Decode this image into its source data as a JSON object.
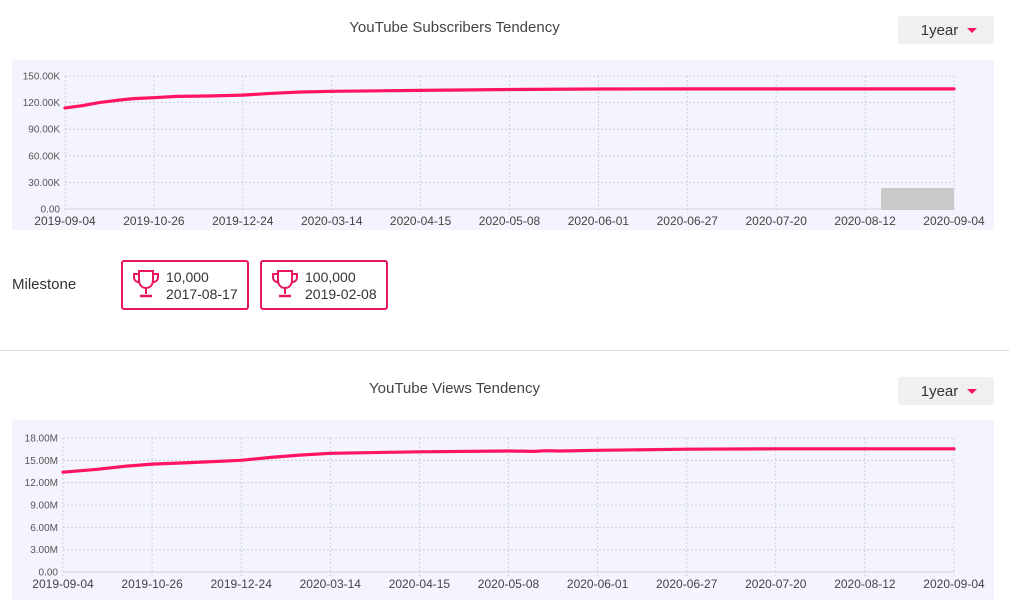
{
  "colors": {
    "line": "#ff1464",
    "plot_bg": "#f3f4fd",
    "grid": "#c8cad6",
    "brush": "#c9c9c9"
  },
  "subscribers": {
    "title": "YouTube Subscribers Tendency",
    "period_label": "1year"
  },
  "milestone": {
    "label": "Milestone",
    "badges": [
      {
        "value": "10,000",
        "date": "2017-08-17",
        "icon": "trophy-icon"
      },
      {
        "value": "100,000",
        "date": "2019-02-08",
        "icon": "trophy-icon"
      }
    ]
  },
  "views": {
    "title": "YouTube Views Tendency",
    "period_label": "1year"
  },
  "chart_data": [
    {
      "type": "line",
      "title": "YouTube Subscribers Tendency",
      "x_ticks": [
        "2019-09-04",
        "2019-10-26",
        "2019-12-24",
        "2020-03-14",
        "2020-04-15",
        "2020-05-08",
        "2020-06-01",
        "2020-06-27",
        "2020-07-20",
        "2020-08-12",
        "2020-09-04"
      ],
      "y_ticks": [
        "0.00",
        "30.00K",
        "60.00K",
        "90.00K",
        "120.00K",
        "150.00K"
      ],
      "ylim": [
        0,
        150000
      ],
      "grid": true,
      "series": [
        {
          "x": [
            "2019-09-04",
            "2019-09-14",
            "2019-09-24",
            "2019-10-04",
            "2019-10-14",
            "2019-10-26",
            "2019-11-10",
            "2019-12-01",
            "2019-12-24",
            "2020-01-20",
            "2020-02-15",
            "2020-03-14",
            "2020-04-15",
            "2020-05-08",
            "2020-06-01",
            "2020-06-27",
            "2020-07-20",
            "2020-08-12",
            "2020-09-04"
          ],
          "y": [
            114000,
            116500,
            120000,
            122500,
            124500,
            125500,
            127000,
            127500,
            128500,
            130500,
            132000,
            132800,
            133800,
            134800,
            135300,
            135500,
            135500,
            135500,
            135500
          ]
        }
      ]
    },
    {
      "type": "line",
      "title": "YouTube Views Tendency",
      "x_ticks": [
        "2019-09-04",
        "2019-10-26",
        "2019-12-24",
        "2020-03-14",
        "2020-04-15",
        "2020-05-08",
        "2020-06-01",
        "2020-06-27",
        "2020-07-20",
        "2020-08-12",
        "2020-09-04"
      ],
      "y_ticks": [
        "0.00",
        "3.00M",
        "6.00M",
        "9.00M",
        "12.00M",
        "15.00M",
        "18.00M"
      ],
      "ylim": [
        0,
        18000000
      ],
      "grid": true,
      "series": [
        {
          "x": [
            "2019-09-04",
            "2019-09-24",
            "2019-10-10",
            "2019-10-26",
            "2019-11-20",
            "2019-12-24",
            "2020-01-20",
            "2020-02-15",
            "2020-03-14",
            "2020-04-15",
            "2020-05-08",
            "2020-05-15",
            "2020-05-18",
            "2020-05-22",
            "2020-06-01",
            "2020-06-27",
            "2020-07-20",
            "2020-08-12",
            "2020-09-04"
          ],
          "y": [
            13400000,
            13800000,
            14200000,
            14500000,
            14700000,
            15000000,
            15400000,
            15700000,
            15950000,
            16150000,
            16250000,
            16200000,
            16300000,
            16250000,
            16350000,
            16500000,
            16550000,
            16550000,
            16550000
          ]
        }
      ]
    }
  ]
}
